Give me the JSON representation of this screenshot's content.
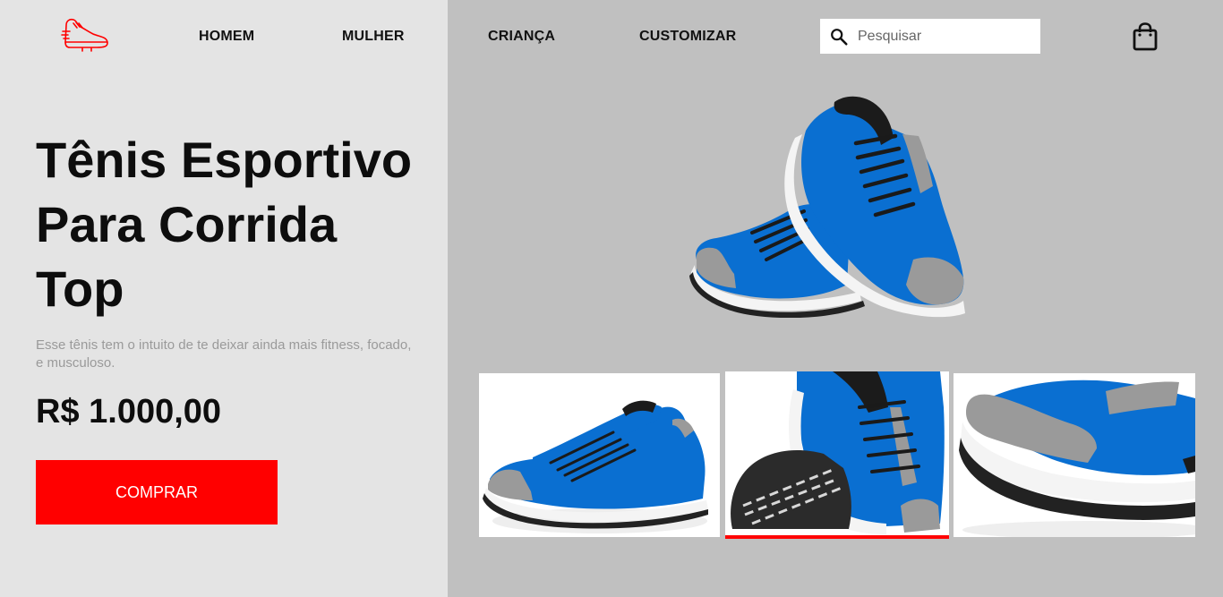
{
  "brand": {
    "logo": "running-shoe-icon"
  },
  "nav": {
    "items": [
      {
        "label": "HOMEM"
      },
      {
        "label": "MULHER"
      },
      {
        "label": "CRIANÇA"
      },
      {
        "label": "CUSTOMIZAR"
      }
    ]
  },
  "search": {
    "placeholder": "Pesquisar",
    "icon": "search-icon"
  },
  "cart": {
    "icon": "shopping-bag-icon"
  },
  "product": {
    "title": "Tênis Esportivo Para Corrida Top",
    "description": "Esse tênis tem o intuito de te deixar ainda mais fitness, focado, e musculoso.",
    "price": "R$ 1.000,00",
    "buy_label": "COMPRAR"
  },
  "gallery": {
    "active_index": 1,
    "count": 3
  },
  "colors": {
    "accent": "#ff0000",
    "left_background": "#e4e4e4",
    "right_background": "#c0c0c0",
    "shoe_blue": "#0a6fd1",
    "shoe_gray": "#9a9a9a"
  }
}
